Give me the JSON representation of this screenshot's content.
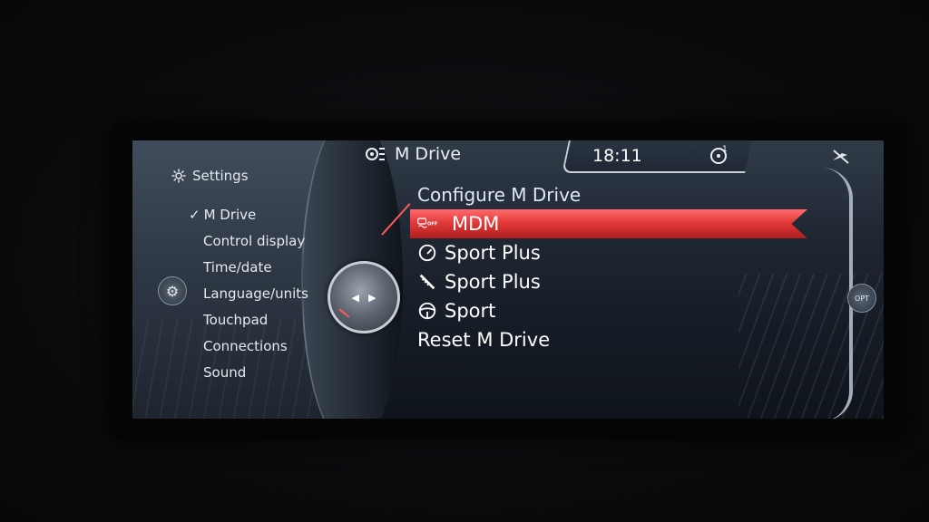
{
  "header": {
    "title": "M Drive",
    "time": "18:11"
  },
  "sidebar": {
    "title": "Settings",
    "items": [
      {
        "label": "M Drive",
        "active": true
      },
      {
        "label": "Control display"
      },
      {
        "label": "Time/date"
      },
      {
        "label": "Language/units"
      },
      {
        "label": "Touchpad"
      },
      {
        "label": "Connections"
      },
      {
        "label": "Sound"
      }
    ]
  },
  "main": {
    "title": "Configure M Drive",
    "items": [
      {
        "label": "MDM",
        "icon": "mdm-off-icon",
        "selected": true
      },
      {
        "label": "Sport Plus",
        "icon": "gauge-icon"
      },
      {
        "label": "Sport Plus",
        "icon": "suspension-icon"
      },
      {
        "label": "Sport",
        "icon": "steering-wheel-icon"
      },
      {
        "label": "Reset M Drive"
      }
    ]
  },
  "controls": {
    "opt_label": "OPT"
  },
  "colors": {
    "highlight": "#e23a3a",
    "text": "#ffffff",
    "background": "#1f2733"
  }
}
